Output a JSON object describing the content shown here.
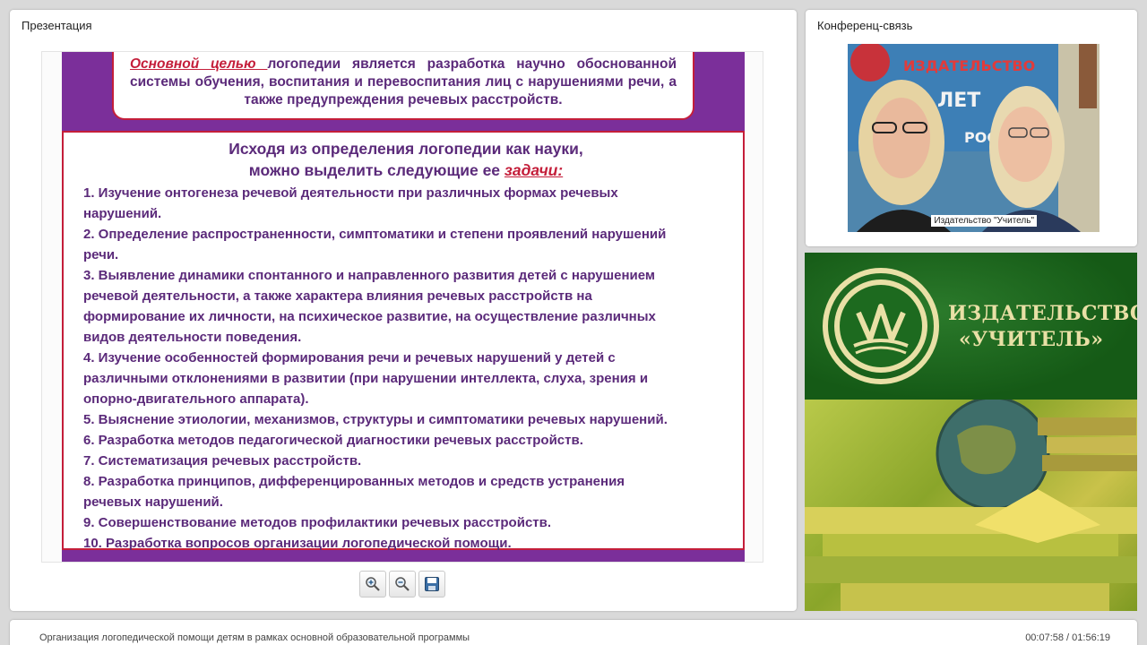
{
  "presentation": {
    "title": "Презентация",
    "slide": {
      "goal_emphasis": "Основной целью ",
      "goal_text": "логопедии является разработка научно обоснованной системы обучения, воспитания и перевоспитания лиц с нарушениями речи, а также предупреждения речевых расстройств.",
      "tasks_heading_line1": "Исходя из определения логопедии как науки,",
      "tasks_heading_line2": "можно выделить следующие ее ",
      "tasks_heading_emphasis": "задачи:",
      "tasks": [
        "1. Изучение онтогенеза речевой деятельности при различных формах речевых\nнарушений.",
        "2. Определение распространенности, симптоматики и степени проявлений нарушений\nречи.",
        "3. Выявление динамики спонтанного и направленного развития детей с нарушением\nречевой деятельности, а также характера влияния речевых расстройств на\nформирование их личности, на психическое развитие, на осуществление различных\nвидов деятельности поведения.",
        "4. Изучение особенностей формирования речи и речевых нарушений у детей с\nразличными отклонениями в развитии (при нарушении интеллекта, слуха, зрения и\nопорно-двигательного аппарата).",
        "5. Выяснение этиологии, механизмов, структуры и симптоматики речевых нарушений.",
        "6. Разработка методов педагогической диагностики речевых расстройств.",
        "7. Систематизация речевых расстройств.",
        "8. Разработка принципов, дифференцированных методов и средств устранения\nречевых нарушений.",
        "9. Совершенствование методов профилактики речевых расстройств.",
        "10. Разработка вопросов организации логопедической помощи."
      ]
    },
    "toolbar": {
      "zoom_in_icon": "zoom-in-icon",
      "zoom_out_icon": "zoom-out-icon",
      "save_icon": "save-icon"
    }
  },
  "conference": {
    "title": "Конференц-связь",
    "video_caption": "Издательство \"Учитель\"",
    "backdrop_text_1": "ИЗДАТЕЛЬСТВО",
    "backdrop_text_2": "ЛЕТ",
    "backdrop_text_3": "РОССИ"
  },
  "promo": {
    "line1": "ИЗДАТЕЛЬСТВО",
    "line2": "«УЧИТЕЛЬ»"
  },
  "footer": {
    "title": "Организация логопедической помощи детям в рамках основной образовательной программы",
    "time": "00:07:58 / 01:56:19"
  },
  "colors": {
    "slide_purple": "#7b2f9a",
    "slide_text": "#5b2a7a",
    "slide_red": "#c41e3a",
    "promo_green": "#155a16",
    "promo_text": "#e9e0a6"
  }
}
